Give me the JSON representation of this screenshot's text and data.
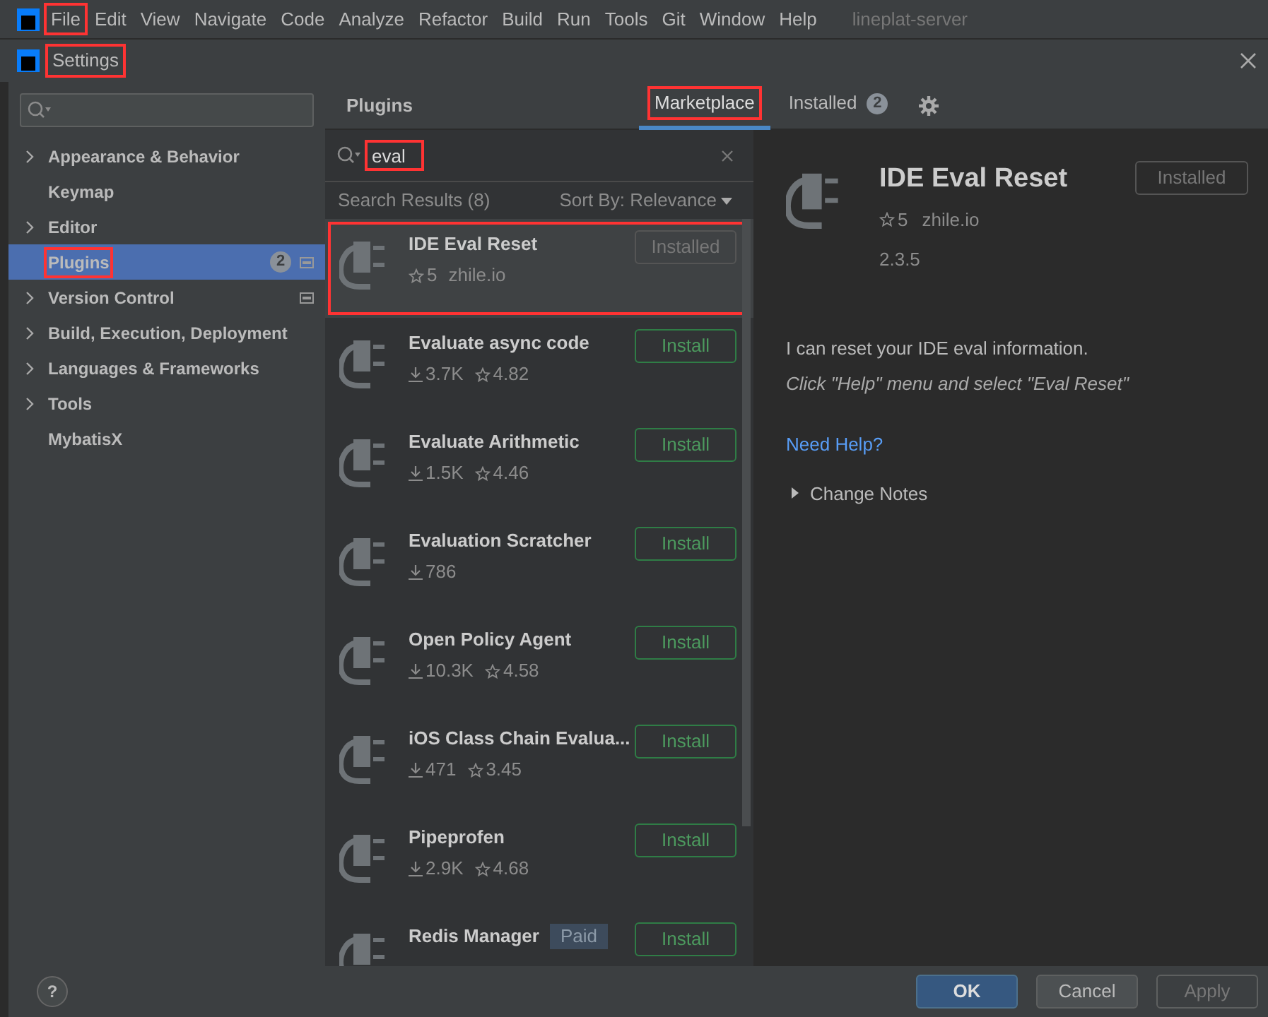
{
  "menu_bar": {
    "items": [
      {
        "label": "File",
        "highlighted": true
      },
      {
        "label": "Edit",
        "highlighted": false
      },
      {
        "label": "View",
        "highlighted": false
      },
      {
        "label": "Navigate",
        "highlighted": false
      },
      {
        "label": "Code",
        "highlighted": false
      },
      {
        "label": "Analyze",
        "highlighted": false
      },
      {
        "label": "Refactor",
        "highlighted": false
      },
      {
        "label": "Build",
        "highlighted": false
      },
      {
        "label": "Run",
        "highlighted": false
      },
      {
        "label": "Tools",
        "highlighted": false
      },
      {
        "label": "Git",
        "highlighted": false
      },
      {
        "label": "Window",
        "highlighted": false
      },
      {
        "label": "Help",
        "highlighted": false
      }
    ],
    "project": "lineplat-server"
  },
  "window": {
    "title": "Settings",
    "title_highlighted": true
  },
  "sidebar": {
    "items": [
      {
        "label": "Appearance & Behavior",
        "expandable": true,
        "selected": false,
        "highlighted": false,
        "scope_icon": false
      },
      {
        "label": "Keymap",
        "expandable": false,
        "selected": false,
        "highlighted": false,
        "scope_icon": false
      },
      {
        "label": "Editor",
        "expandable": true,
        "selected": false,
        "highlighted": false,
        "scope_icon": false
      },
      {
        "label": "Plugins",
        "expandable": false,
        "selected": true,
        "highlighted": true,
        "badge": "2",
        "scope_icon": true
      },
      {
        "label": "Version Control",
        "expandable": true,
        "selected": false,
        "highlighted": false,
        "scope_icon": true
      },
      {
        "label": "Build, Execution, Deployment",
        "expandable": true,
        "selected": false,
        "highlighted": false,
        "scope_icon": false
      },
      {
        "label": "Languages & Frameworks",
        "expandable": true,
        "selected": false,
        "highlighted": false,
        "scope_icon": false
      },
      {
        "label": "Tools",
        "expandable": true,
        "selected": false,
        "highlighted": false,
        "scope_icon": false
      },
      {
        "label": "MybatisX",
        "expandable": false,
        "selected": false,
        "highlighted": false,
        "scope_icon": false
      }
    ]
  },
  "header": {
    "title": "Plugins",
    "tabs": [
      {
        "label": "Marketplace",
        "selected": true,
        "highlighted": true
      },
      {
        "label": "Installed",
        "selected": false,
        "highlighted": false,
        "badge": "2"
      }
    ]
  },
  "search": {
    "value": "eval",
    "highlighted": true
  },
  "results": {
    "title": "Search Results (8)",
    "sort": "Sort By: Relevance"
  },
  "plugins": [
    {
      "name": "IDE Eval Reset",
      "rating": "5",
      "vendor": "zhile.io",
      "button": "Installed",
      "installed": true,
      "selected": true,
      "highlighted": true
    },
    {
      "name": "Evaluate async code",
      "downloads": "3.7K",
      "rating": "4.82",
      "button": "Install",
      "installed": false,
      "selected": false,
      "highlighted": false
    },
    {
      "name": "Evaluate Arithmetic",
      "downloads": "1.5K",
      "rating": "4.46",
      "button": "Install",
      "installed": false,
      "selected": false,
      "highlighted": false
    },
    {
      "name": "Evaluation Scratcher",
      "downloads": "786",
      "button": "Install",
      "installed": false,
      "selected": false,
      "highlighted": false
    },
    {
      "name": "Open Policy Agent",
      "downloads": "10.3K",
      "rating": "4.58",
      "button": "Install",
      "installed": false,
      "selected": false,
      "highlighted": false
    },
    {
      "name": "iOS Class Chain Evalua...",
      "downloads": "471",
      "rating": "3.45",
      "button": "Install",
      "installed": false,
      "selected": false,
      "highlighted": false
    },
    {
      "name": "Pipeprofen",
      "downloads": "2.9K",
      "rating": "4.68",
      "button": "Install",
      "installed": false,
      "selected": false,
      "highlighted": false
    },
    {
      "name": "Redis Manager",
      "tag": "Paid",
      "button": "Install",
      "installed": false,
      "selected": false,
      "highlighted": false
    }
  ],
  "detail": {
    "name": "IDE Eval Reset",
    "button": "Installed",
    "rating": "5",
    "vendor": "zhile.io",
    "version": "2.3.5",
    "description": "I can reset your IDE eval information.",
    "hint": "Click \"Help\" menu and select \"Eval Reset\"",
    "link": "Need Help?",
    "change_notes": "Change Notes"
  },
  "footer": {
    "help": "?",
    "buttons": [
      "OK",
      "Cancel",
      "Apply"
    ]
  }
}
